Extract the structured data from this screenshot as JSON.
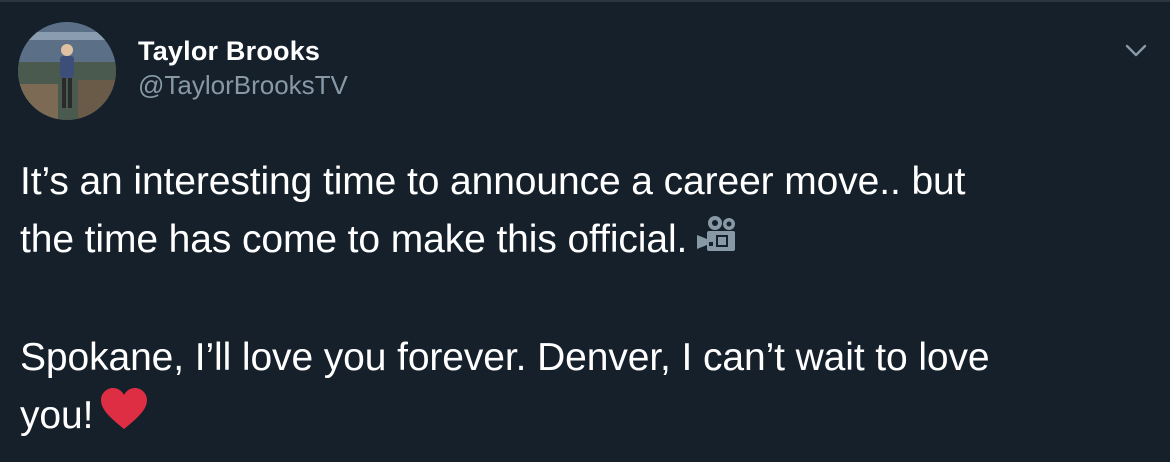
{
  "tweet": {
    "author": {
      "display_name": "Taylor Brooks",
      "handle": "@TaylorBrooksTV"
    },
    "menu_icon": "chevron-down-icon",
    "text": {
      "line1": "It’s an interesting time to announce a career move.. but",
      "line2": "the time has come to make this official.",
      "emoji1": "movie-camera-icon",
      "line3": "Spokane, I’ll love you forever. Denver, I can’t wait to love",
      "line4": "you!",
      "emoji2": "red-heart-icon"
    }
  },
  "colors": {
    "background": "#15202b",
    "primary_text": "#ffffff",
    "secondary_text": "#8899a6",
    "heart": "#dd2e44"
  }
}
